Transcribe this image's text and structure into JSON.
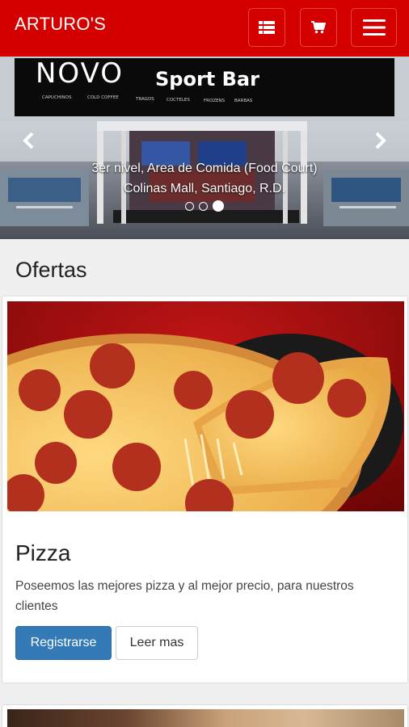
{
  "navbar": {
    "brand": "ARTURO'S",
    "buttons": [
      {
        "icon": "grid-icon"
      },
      {
        "icon": "cart-icon"
      },
      {
        "icon": "hamburger-menu-icon"
      }
    ],
    "color": "#d40000"
  },
  "carousel": {
    "sign_logo": "NOVO",
    "sign_name": "Sport Bar",
    "sign_menu": [
      "CAPUCHINOS",
      "COLD COFFEE",
      "TRAGOS",
      "COCTELES",
      "FROZENS",
      "BARBAS"
    ],
    "caption_line1": "3er nivel, Area de Comida (Food Court)",
    "caption_line2": "Colinas Mall, Santiago, R.D.",
    "slide_count": 3,
    "active_slide": 3,
    "prev_icon": "chevron-left-icon",
    "next_icon": "chevron-right-icon"
  },
  "section": {
    "title": "Ofertas"
  },
  "offers": [
    {
      "title": "Pizza",
      "description": "Poseemos las mejores pizza y al mejor precio, para nuestros clientes",
      "primary_label": "Registrarse",
      "secondary_label": "Leer mas"
    }
  ],
  "colors": {
    "primary_button": "#337ab7",
    "navbar": "#d40000"
  }
}
